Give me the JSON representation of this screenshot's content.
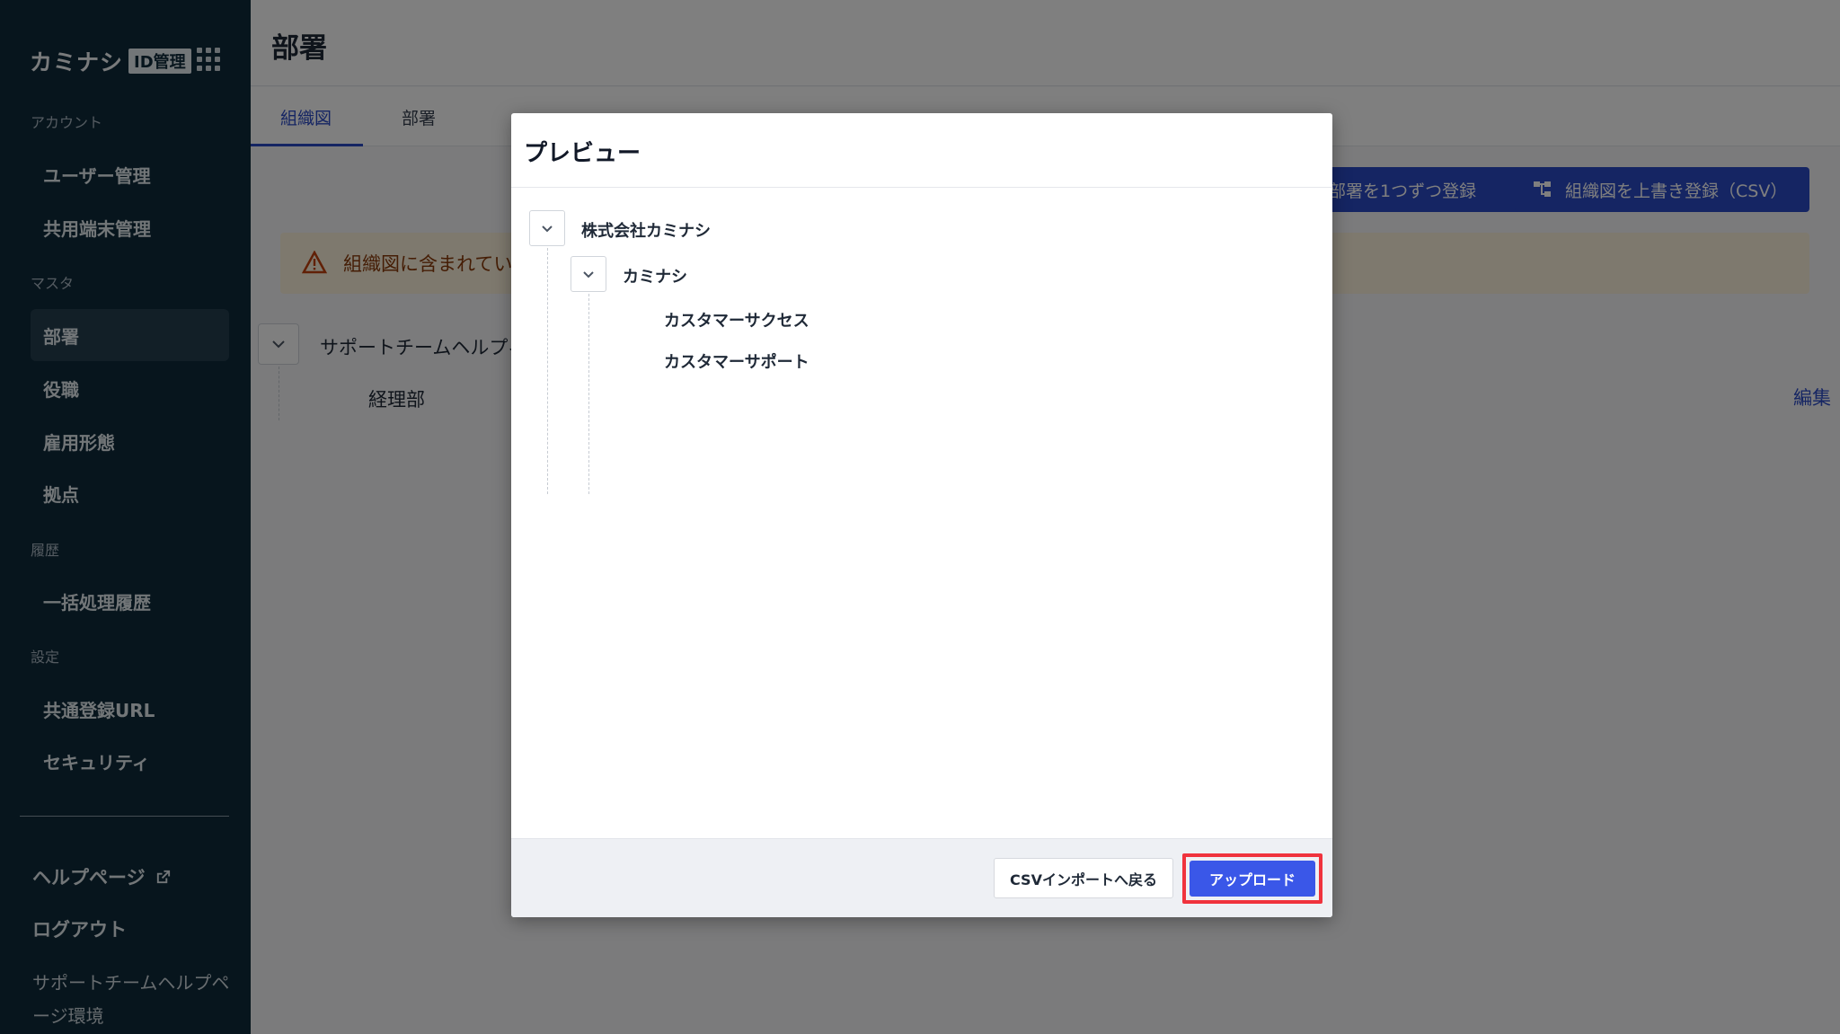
{
  "sidebar": {
    "logo_text": "カミナシ",
    "logo_badge": "ID管理",
    "sections": {
      "account": "アカウント",
      "master": "マスタ",
      "history": "履歴",
      "settings": "設定"
    },
    "items": {
      "users": "ユーザー管理",
      "shared_devices": "共用端末管理",
      "departments": "部署",
      "positions": "役職",
      "employment": "雇用形態",
      "locations": "拠点",
      "batch_history": "一括処理履歴",
      "shared_url": "共通登録URL",
      "security": "セキュリティ"
    },
    "help": "ヘルプページ",
    "logout": "ログアウト",
    "environment": "サポートチームヘルプページ環境"
  },
  "header": {
    "title": "部署"
  },
  "tabs": [
    {
      "label": "組織図",
      "active": true
    },
    {
      "label": "部署",
      "active": false
    }
  ],
  "actions": {
    "register_one": "部署を1つずつ登録",
    "overwrite_csv": "組織図を上書き登録（CSV）"
  },
  "warning_text": "組織図に含まれてい",
  "tree": {
    "root": "サポートチームヘルプィ",
    "child": "経理部",
    "edit": "編集"
  },
  "modal": {
    "title": "プレビュー",
    "tree": {
      "root": "株式会社カミナシ",
      "child": "カミナシ",
      "leaves": [
        "カスタマーサクセス",
        "カスタマーサポート"
      ]
    },
    "back_button": "CSVインポートへ戻る",
    "upload_button": "アップロード"
  },
  "colors": {
    "sidebar_bg": "#0f2a3a",
    "primary": "#2b4ac7",
    "upload": "#3a57e8",
    "highlight": "#f0333d"
  }
}
